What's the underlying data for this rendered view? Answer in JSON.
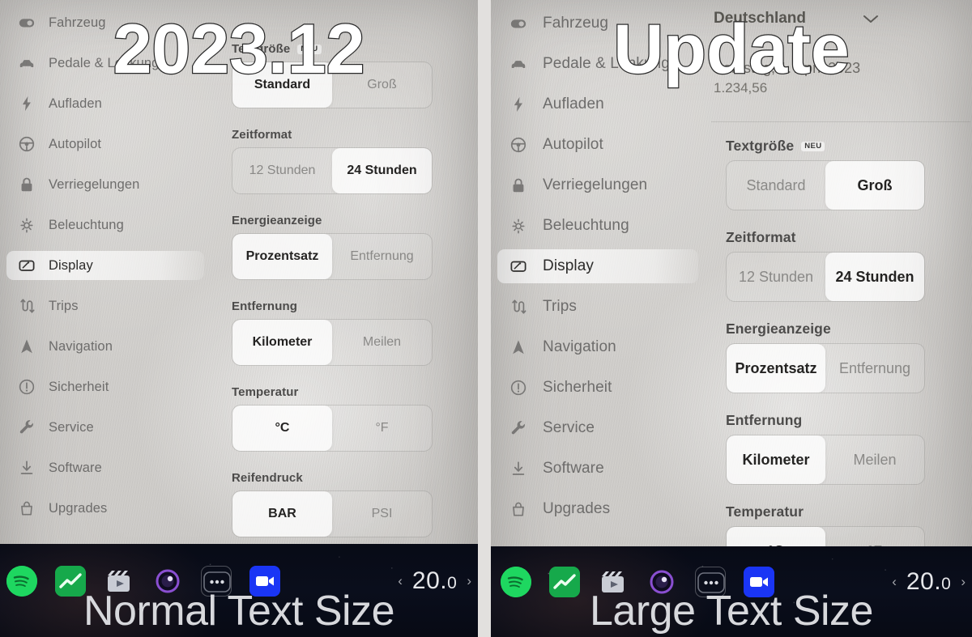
{
  "overlay": {
    "version_label": "2023.12",
    "update_label": "Update",
    "left_caption": "Normal Text Size",
    "right_caption": "Large Text Size"
  },
  "sidebar": {
    "items": [
      {
        "label": "Fahrzeug",
        "icon": "toggle-icon",
        "active": false
      },
      {
        "label": "Pedale & Lenkung",
        "icon": "car-icon",
        "active": false
      },
      {
        "label": "Aufladen",
        "icon": "bolt-icon",
        "active": false
      },
      {
        "label": "Autopilot",
        "icon": "steering-wheel-icon",
        "active": false
      },
      {
        "label": "Verriegelungen",
        "icon": "lock-icon",
        "active": false
      },
      {
        "label": "Beleuchtung",
        "icon": "light-icon",
        "active": false
      },
      {
        "label": "Display",
        "icon": "display-icon",
        "active": true
      },
      {
        "label": "Trips",
        "icon": "trips-icon",
        "active": false
      },
      {
        "label": "Navigation",
        "icon": "navigation-icon",
        "active": false
      },
      {
        "label": "Sicherheit",
        "icon": "alert-circle-icon",
        "active": false
      },
      {
        "label": "Service",
        "icon": "wrench-icon",
        "active": false
      },
      {
        "label": "Software",
        "icon": "download-icon",
        "active": false
      },
      {
        "label": "Upgrades",
        "icon": "bag-icon",
        "active": false
      }
    ]
  },
  "left_panel": {
    "caption": "Normal Text Size",
    "groups": [
      {
        "label": "Textgröße",
        "badge": "NEU",
        "options": [
          "Standard",
          "Groß"
        ],
        "selected": "Standard"
      },
      {
        "label": "Zeitformat",
        "badge": "",
        "options": [
          "12 Stunden",
          "24 Stunden"
        ],
        "selected": "24 Stunden"
      },
      {
        "label": "Energieanzeige",
        "badge": "",
        "options": [
          "Prozentsatz",
          "Entfernung"
        ],
        "selected": "Prozentsatz"
      },
      {
        "label": "Entfernung",
        "badge": "",
        "options": [
          "Kilometer",
          "Meilen"
        ],
        "selected": "Kilometer"
      },
      {
        "label": "Temperatur",
        "badge": "",
        "options": [
          "°C",
          "°F"
        ],
        "selected": "°C"
      },
      {
        "label": "Reifendruck",
        "badge": "",
        "options": [
          "BAR",
          "PSI"
        ],
        "selected": "BAR"
      }
    ]
  },
  "right_panel": {
    "caption": "Large Text Size",
    "header": {
      "country": "Deutschland",
      "date": "Samstag, 1. April 2023",
      "amount": "1.234,56"
    },
    "groups": [
      {
        "label": "Textgröße",
        "badge": "NEU",
        "options": [
          "Standard",
          "Groß"
        ],
        "selected": "Groß"
      },
      {
        "label": "Zeitformat",
        "badge": "",
        "options": [
          "12 Stunden",
          "24 Stunden"
        ],
        "selected": "24 Stunden"
      },
      {
        "label": "Energieanzeige",
        "badge": "",
        "options": [
          "Prozentsatz",
          "Entfernung"
        ],
        "selected": "Prozentsatz"
      },
      {
        "label": "Entfernung",
        "badge": "",
        "options": [
          "Kilometer",
          "Meilen"
        ],
        "selected": "Kilometer"
      },
      {
        "label": "Temperatur",
        "badge": "",
        "options": [
          "°C",
          "°F"
        ],
        "selected": "°C"
      }
    ]
  },
  "taskbar": {
    "apps": [
      {
        "name": "spotify-app-icon"
      },
      {
        "name": "energy-app-icon"
      },
      {
        "name": "theater-app-icon"
      },
      {
        "name": "camera-app-icon"
      },
      {
        "name": "more-apps-icon"
      },
      {
        "name": "video-app-icon"
      }
    ],
    "temperature": "20.0",
    "temp_whole": "20.",
    "temp_dec": "0",
    "prev_arrow": "‹",
    "next_arrow": "›"
  },
  "colors": {
    "screen_bg": "#d5d3d0",
    "taskbar_bg": "#0a0e1c",
    "accent_selected": "#ffffff",
    "text_primary": "#2c2b2a",
    "text_muted": "#8a8987",
    "spotify_green": "#1ed760",
    "video_blue": "#1a35f5"
  }
}
